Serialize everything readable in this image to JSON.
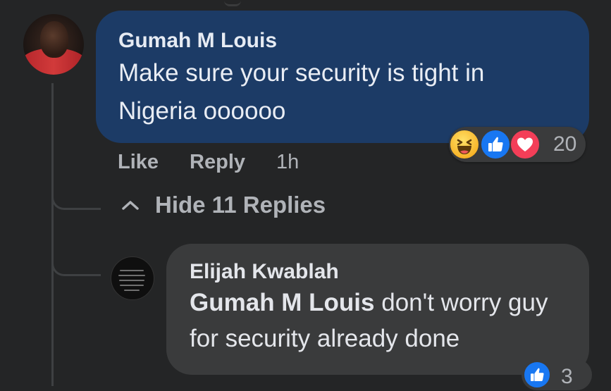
{
  "comment": {
    "author": "Gumah M Louis",
    "text": "Make sure your security is tight in Nigeria oooooo",
    "actions": {
      "like": "Like",
      "reply": "Reply",
      "time": "1h"
    },
    "reactions": {
      "icons": [
        "haha-icon",
        "like-icon",
        "love-icon"
      ],
      "count": "20"
    }
  },
  "toggle": {
    "label": "Hide 11 Replies",
    "icon": "chevron-up-icon"
  },
  "reply": {
    "author": "Elijah Kwablah",
    "mention": "Gumah M Louis",
    "text": " don't worry guy for security already done",
    "reactions": {
      "icons": [
        "like-icon"
      ],
      "count": "3"
    }
  },
  "colors": {
    "background": "#242526",
    "highlight_bubble": "#1c3b66",
    "reply_bubble": "#3a3b3c",
    "secondary_text": "#b0b3b8",
    "like_blue": "#1877f2",
    "love_red": "#f33e58",
    "haha_yellow": "#f7b125"
  }
}
